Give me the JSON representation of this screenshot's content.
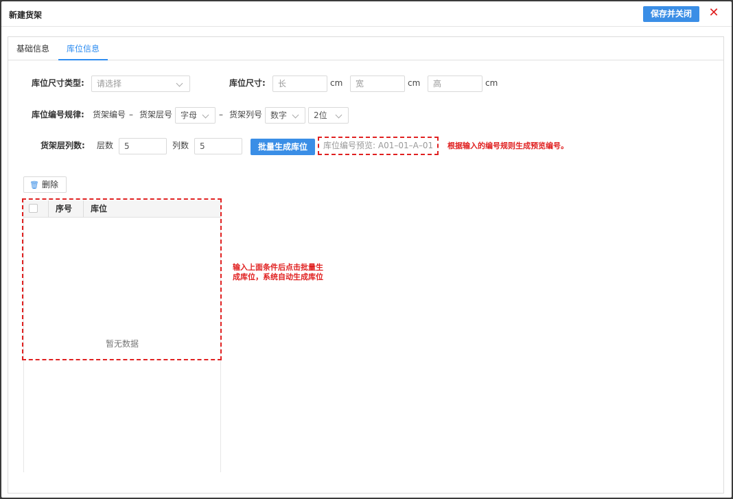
{
  "dialog": {
    "title": "新建货架",
    "save_label": "保存并关闭",
    "close_icon": "close-icon"
  },
  "tabs": [
    {
      "label": "基础信息",
      "active": false
    },
    {
      "label": "库位信息",
      "active": true
    }
  ],
  "form": {
    "size_type": {
      "label": "库位尺寸类型:",
      "placeholder": "请选择"
    },
    "size": {
      "label": "库位尺寸:",
      "length_placeholder": "长",
      "width_placeholder": "宽",
      "height_placeholder": "高",
      "unit": "cm"
    },
    "code_rule": {
      "label": "库位编号规律:",
      "shelf_code": "货架编号",
      "dash": "–",
      "layer_code_label": "货架层号",
      "layer_code_value": "字母",
      "column_code_label": "货架列号",
      "column_code_value": "数字",
      "digits_value": "2位"
    },
    "layers_columns": {
      "label": "货架层列数:",
      "layers_label": "层数",
      "layers_value": "5",
      "columns_label": "列数",
      "columns_value": "5",
      "generate_label": "批量生成库位",
      "preview_placeholder": "库位编号预览: A01–01–A–01"
    }
  },
  "annotations": {
    "preview_note": "根据输入的编号规则生成预览编号。",
    "table_note_line1": "输入上面条件后点击批量生",
    "table_note_line2": "成库位，系统自动生成库位",
    "color": "#e02020"
  },
  "toolbar": {
    "delete_label": "删除"
  },
  "table": {
    "columns": [
      "序号",
      "库位"
    ],
    "rows": [],
    "empty_text": "暂无数据"
  },
  "colors": {
    "primary": "#3a8ee6",
    "tab_active": "#2d8cf0",
    "close": "#e02020"
  }
}
